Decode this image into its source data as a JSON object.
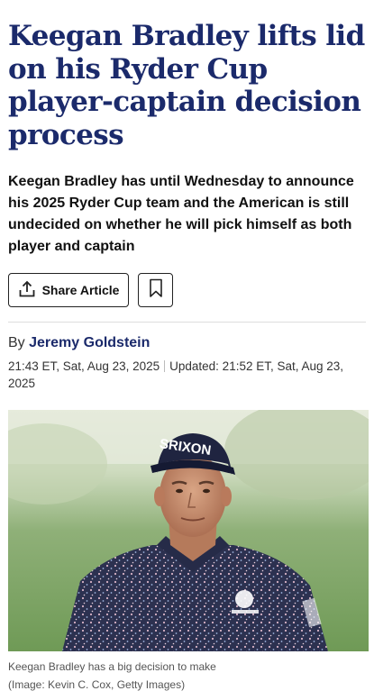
{
  "article": {
    "headline": "Keegan Bradley lifts lid on his Ryder Cup player-captain decision process",
    "standfirst": "Keegan Bradley has until Wednesday to announce his 2025 Ryder Cup team and the American is still undecided on whether he will pick himself as both player and captain",
    "share_label": "Share Article",
    "byline_prefix": "By",
    "author": "Jeremy Goldstein",
    "published": "21:43 ET, Sat, Aug 23, 2025",
    "updated": "Updated: 21:52 ET, Sat, Aug 23, 2025",
    "image": {
      "cap_brand": "SRIXON",
      "caption": "Keegan Bradley has a big decision to make",
      "credit": "(Image: Kevin C. Cox, Getty Images)"
    }
  },
  "colors": {
    "headline": "#1b2a6b",
    "author": "#1b2a6b"
  },
  "icons": {
    "share": "share-upload-icon",
    "save": "bookmark-icon"
  }
}
